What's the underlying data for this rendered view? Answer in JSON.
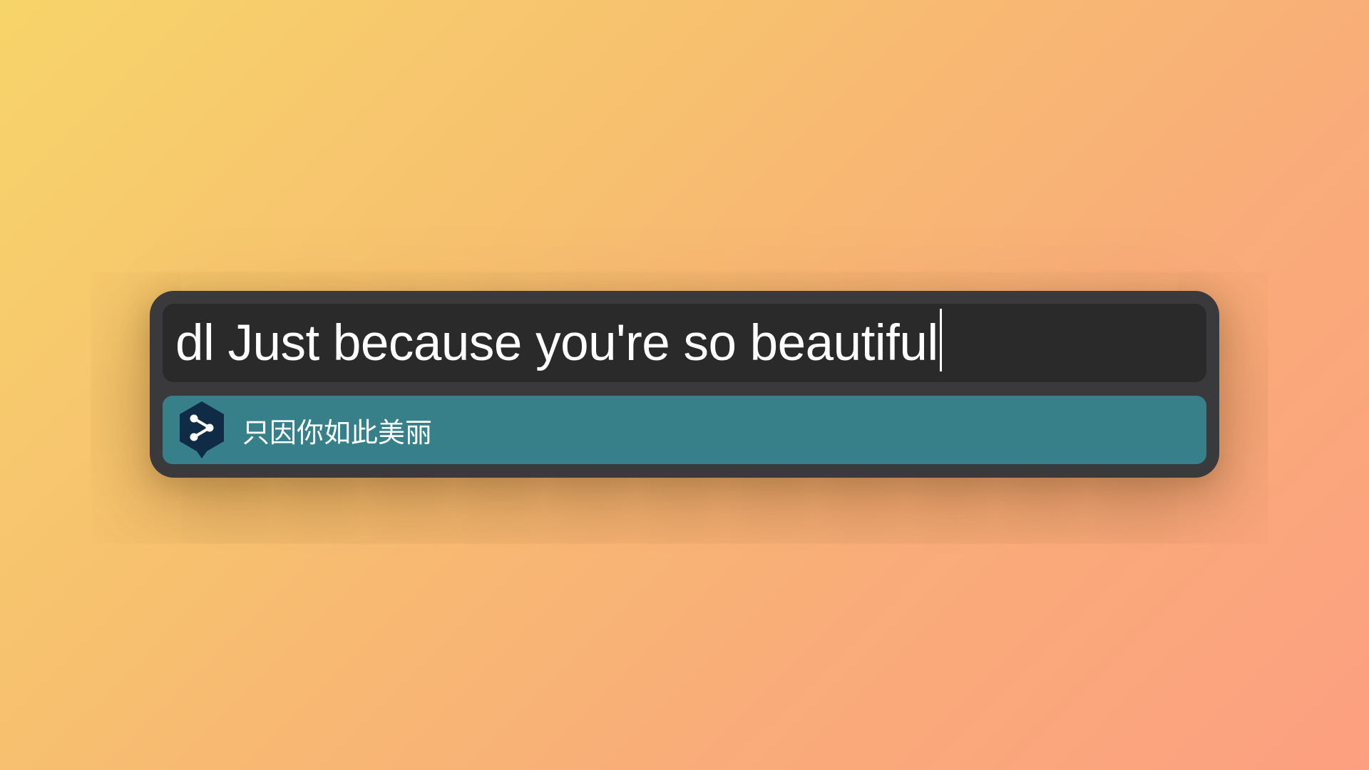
{
  "launcher": {
    "query": "dl Just because you're so beautiful",
    "results": [
      {
        "icon": "deepl-icon",
        "text": "只因你如此美丽",
        "selected": true
      }
    ]
  },
  "colors": {
    "window_background": "#3a3a3c",
    "input_background": "#2a2a2b",
    "selection_highlight": "#37808a",
    "icon_background": "#0f2b46"
  }
}
